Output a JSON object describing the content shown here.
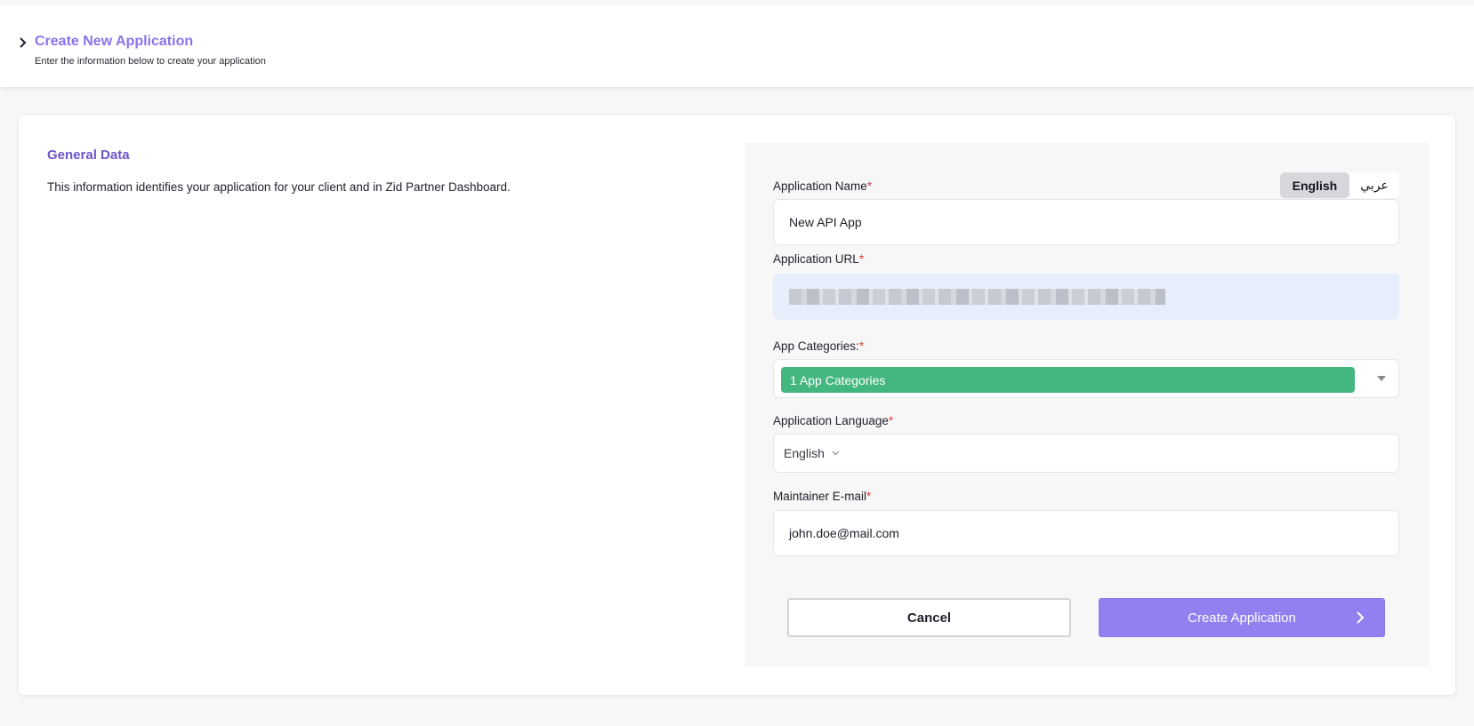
{
  "header": {
    "title": "Create New Application",
    "subtitle": "Enter the information below to create your application"
  },
  "general": {
    "title": "General Data",
    "description": "This information identifies your application for your client and in Zid Partner Dashboard."
  },
  "form": {
    "language_toggle": {
      "options": [
        "English",
        "عربي"
      ],
      "active": "English"
    },
    "app_name": {
      "label": "Application Name",
      "required_mark": "*",
      "value": "New API App"
    },
    "app_url": {
      "label": "Application URL",
      "required_mark": "*"
    },
    "app_categories": {
      "label": "App Categories:",
      "required_mark": "*",
      "selected_tag": "1 App Categories"
    },
    "app_language": {
      "label": "Application Language",
      "required_mark": "*",
      "value": "English"
    },
    "maintainer_email": {
      "label": "Maintainer E-mail",
      "required_mark": "*",
      "value": "john.doe@mail.com"
    },
    "buttons": {
      "cancel": "Cancel",
      "create": "Create Application"
    }
  },
  "colors": {
    "accent": "#8a73ea",
    "section_title": "#6a55c9",
    "tag_green": "#44b77f",
    "primary_button": "#9080f0",
    "required": "#e53e3e",
    "url_field_bg": "#e7eefb"
  },
  "icons": [
    "chevron-right-icon",
    "caret-down-icon",
    "chevron-down-icon",
    "arrow-right-icon"
  ]
}
